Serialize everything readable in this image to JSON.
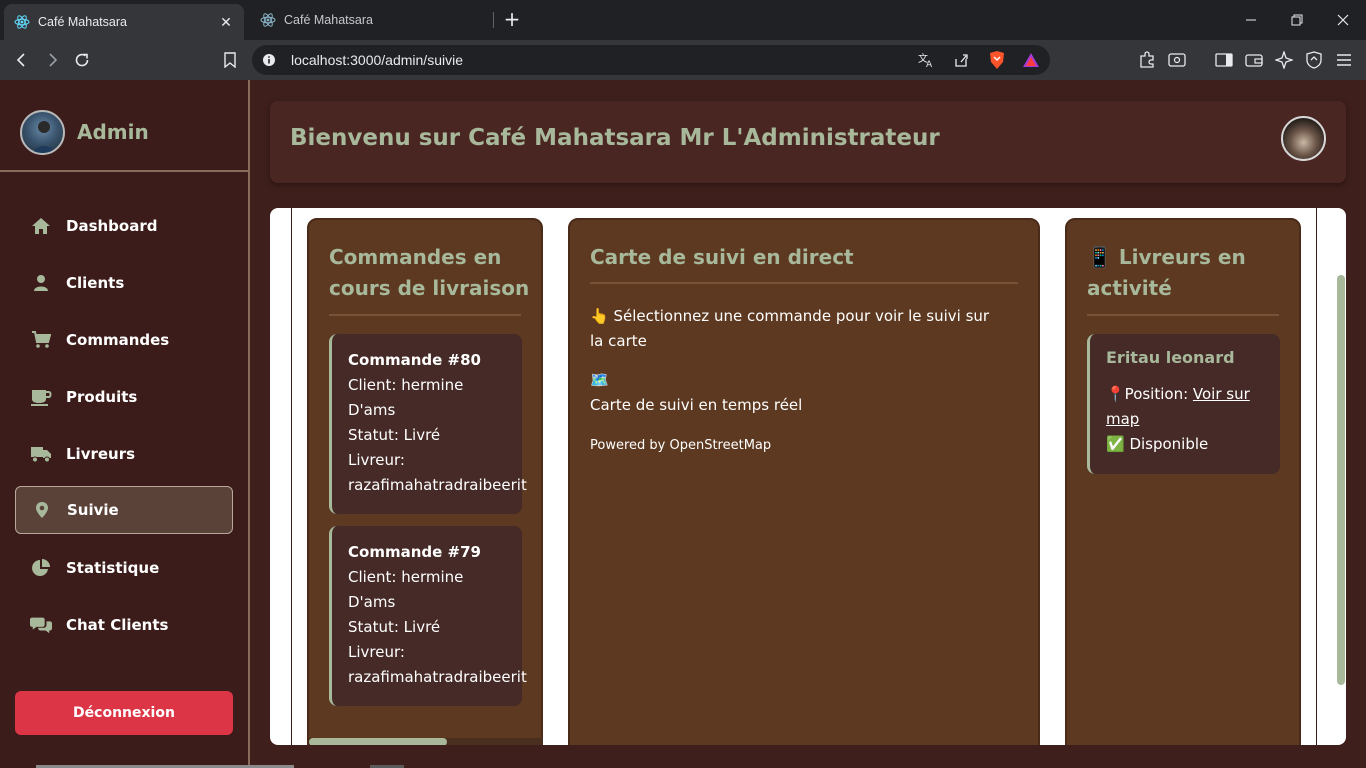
{
  "browser": {
    "tabs": [
      {
        "title": "Café Mahatsara",
        "active": true
      },
      {
        "title": "Café Mahatsara",
        "active": false
      }
    ],
    "url": "localhost:3000/admin/suivie"
  },
  "sidebar": {
    "title": "Admin",
    "items": [
      {
        "label": "Dashboard",
        "icon": "home-icon",
        "active": false
      },
      {
        "label": "Clients",
        "icon": "user-icon",
        "active": false
      },
      {
        "label": "Commandes",
        "icon": "cart-icon",
        "active": false
      },
      {
        "label": "Produits",
        "icon": "mug-icon",
        "active": false
      },
      {
        "label": "Livreurs",
        "icon": "truck-icon",
        "active": false
      },
      {
        "label": "Suivie",
        "icon": "map-pin-icon",
        "active": true
      },
      {
        "label": "Statistique",
        "icon": "pie-chart-icon",
        "active": false
      },
      {
        "label": "Chat Clients",
        "icon": "chat-icon",
        "active": false
      }
    ],
    "logout_label": "Déconnexion"
  },
  "header": {
    "title": "Bienvenu sur Café Mahatsara Mr L'Administrateur"
  },
  "orders_panel": {
    "title_line1": "Commandes en",
    "title_line2": "cours de livraison",
    "orders": [
      {
        "title": "Commande #80",
        "client_label": "Client: hermine",
        "client_rest": "D'ams",
        "status": "Statut: Livré",
        "livreur_label": "Livreur:",
        "livreur": "razafimahatradraibeerit"
      },
      {
        "title": "Commande #79",
        "client_label": "Client: hermine",
        "client_rest": "D'ams",
        "status": "Statut: Livré",
        "livreur_label": "Livreur:",
        "livreur": "razafimahatradraibeerit"
      }
    ]
  },
  "map_panel": {
    "title": "Carte de suivi en direct",
    "hint_line1": "👆 Sélectionnez une commande pour voir le suivi sur",
    "hint_line2": "la carte",
    "map_icon": "🗺️",
    "map_caption": "Carte de suivi en temps réel",
    "powered": "Powered by OpenStreetMap"
  },
  "livreurs_panel": {
    "title_line1": "📱 Livreurs en",
    "title_line2": "activité",
    "livreurs": [
      {
        "name": "Eritau leonard",
        "position_label": "📍Position: ",
        "link_line1": "Voir sur",
        "link_line2": "map",
        "status": "✅ Disponible"
      }
    ]
  },
  "colors": {
    "accent": "#a8b89a",
    "sidebar_bg": "#3b1c1a",
    "panel_bg": "#5c3920",
    "card_bg": "#452a27",
    "logout": "#dc3545"
  }
}
